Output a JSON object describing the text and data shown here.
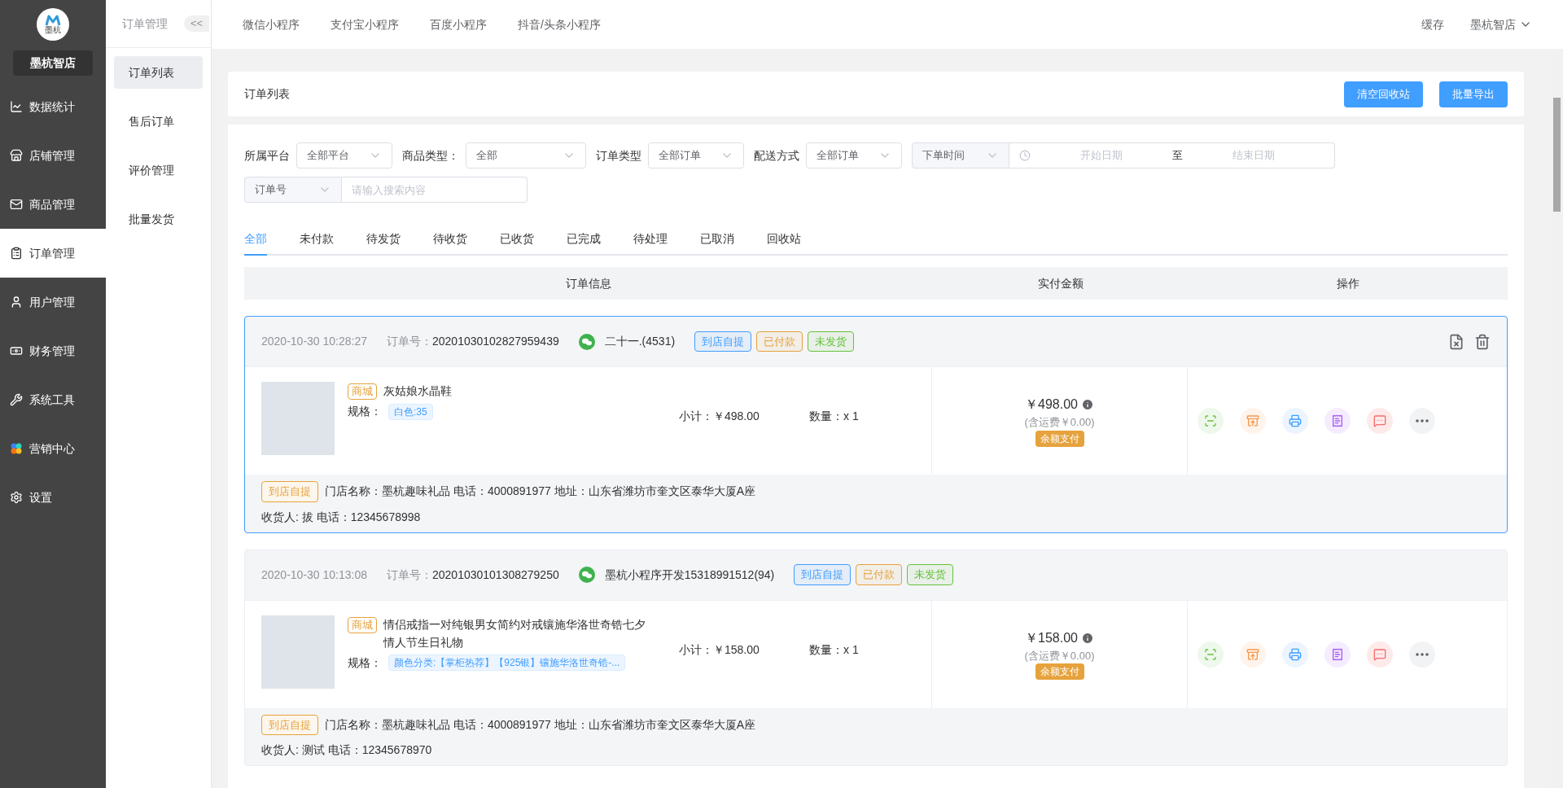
{
  "sidebar": {
    "logo_text": "墨杭",
    "store_name": "墨杭智店",
    "items": [
      {
        "label": "数据统计",
        "selected": false
      },
      {
        "label": "店铺管理",
        "selected": false
      },
      {
        "label": "商品管理",
        "selected": false
      },
      {
        "label": "订单管理",
        "selected": true
      },
      {
        "label": "用户管理",
        "selected": false
      },
      {
        "label": "财务管理",
        "selected": false
      },
      {
        "label": "系统工具",
        "selected": false
      },
      {
        "label": "营销中心",
        "selected": false
      },
      {
        "label": "设置",
        "selected": false
      }
    ]
  },
  "subnav": {
    "title": "订单管理",
    "collapse": "<<",
    "items": [
      {
        "label": "订单列表",
        "selected": true
      },
      {
        "label": "售后订单",
        "selected": false
      },
      {
        "label": "评价管理",
        "selected": false
      },
      {
        "label": "批量发货",
        "selected": false
      }
    ]
  },
  "topbar": {
    "tabs": [
      "微信小程序",
      "支付宝小程序",
      "百度小程序",
      "抖音/头条小程序"
    ],
    "cache": "缓存",
    "user": "墨杭智店"
  },
  "page": {
    "title": "订单列表",
    "buttons": [
      "清空回收站",
      "批量导出"
    ]
  },
  "filters": {
    "row1": [
      {
        "label": "所属平台",
        "value": "全部平台"
      },
      {
        "label": "商品类型：",
        "value": "全部"
      },
      {
        "label": "订单类型",
        "value": "全部订单"
      },
      {
        "label": "配送方式",
        "value": "全部订单"
      }
    ],
    "date": {
      "type": "下单时间",
      "start_placeholder": "开始日期",
      "separator": "至",
      "end_placeholder": "结束日期"
    },
    "search": {
      "type": "订单号",
      "placeholder": "请输入搜索内容"
    }
  },
  "status_tabs": [
    {
      "label": "全部",
      "selected": true
    },
    {
      "label": "未付款",
      "selected": false
    },
    {
      "label": "待发货",
      "selected": false
    },
    {
      "label": "待收货",
      "selected": false
    },
    {
      "label": "已收货",
      "selected": false
    },
    {
      "label": "已完成",
      "selected": false
    },
    {
      "label": "待处理",
      "selected": false
    },
    {
      "label": "已取消",
      "selected": false
    },
    {
      "label": "回收站",
      "selected": false
    }
  ],
  "table": {
    "columns": [
      "订单信息",
      "实付金额",
      "操作"
    ]
  },
  "orders": [
    {
      "selected": true,
      "time": "2020-10-30 10:28:27",
      "order_no_label": "订单号：",
      "order_no": "20201030102827959439",
      "buyer": "二十一.(4531)",
      "tags": [
        {
          "text": "到店自提",
          "color": "#409eff"
        },
        {
          "text": "已付款",
          "color": "#e6a23c"
        },
        {
          "text": "未发货",
          "color": "#67c23a"
        }
      ],
      "item": {
        "source": "商城",
        "name": "灰姑娘水晶鞋",
        "spec_label": "规格：",
        "spec": "白色:35",
        "subtotal": "小计：￥498.00",
        "quantity": "数量：x 1"
      },
      "amount": "￥498.00",
      "shipping": "(含运费￥0.00)",
      "pay_method": "余额支付",
      "delivery": "到店自提",
      "store_line": "门店名称：墨杭趣味礼品 电话：4000891977 地址：山东省潍坊市奎文区泰华大厦A座",
      "consignee": "收货人: 拔 电话：12345678998"
    },
    {
      "selected": false,
      "time": "2020-10-30 10:13:08",
      "order_no_label": "订单号：",
      "order_no": "20201030101308279250",
      "buyer": "墨杭小程序开发15318991512(94)",
      "tags": [
        {
          "text": "到店自提",
          "color": "#409eff"
        },
        {
          "text": "已付款",
          "color": "#e6a23c"
        },
        {
          "text": "未发货",
          "color": "#67c23a"
        }
      ],
      "item": {
        "source": "商城",
        "name": "情侣戒指一对纯银男女简约对戒镶施华洛世奇锆七夕情人节生日礼物",
        "spec_label": "规格：",
        "spec": "颜色分类:【掌柜热荐】【925银】镶施华洛世奇锆-...",
        "subtotal": "小计：￥158.00",
        "quantity": "数量：x 1"
      },
      "amount": "￥158.00",
      "shipping": "(含运费￥0.00)",
      "pay_method": "余额支付",
      "delivery": "到店自提",
      "store_line": "门店名称：墨杭趣味礼品 电话：4000891977 地址：山东省潍坊市奎文区泰华大厦A座",
      "consignee": "收货人: 测试 电话：12345678970"
    }
  ]
}
